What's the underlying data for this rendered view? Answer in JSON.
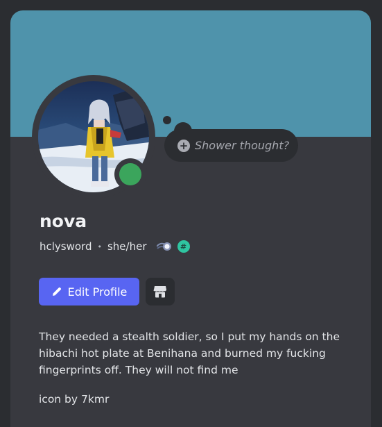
{
  "profile": {
    "display_name": "nova",
    "username": "hclysword",
    "separator": "•",
    "pronouns": "she/her",
    "status": "online",
    "status_color": "#3ba55c",
    "banner_color": "#4f93ab"
  },
  "custom_status": {
    "placeholder": "Shower thought?",
    "icon": "plus-circle-icon"
  },
  "badges": [
    {
      "name": "orb-icon"
    },
    {
      "name": "hash-icon",
      "label": "#"
    }
  ],
  "actions": {
    "edit_label": "Edit Profile",
    "edit_icon": "pencil-icon",
    "shop_icon": "shop-icon",
    "accent_color": "#5865f2"
  },
  "bio": {
    "text": "They needed a stealth soldier, so I put my hands on the\nhibachi hot plate at Benihana and burned my fucking\nfingerprints off. They will not find me",
    "credit": "icon by 7kmr"
  }
}
